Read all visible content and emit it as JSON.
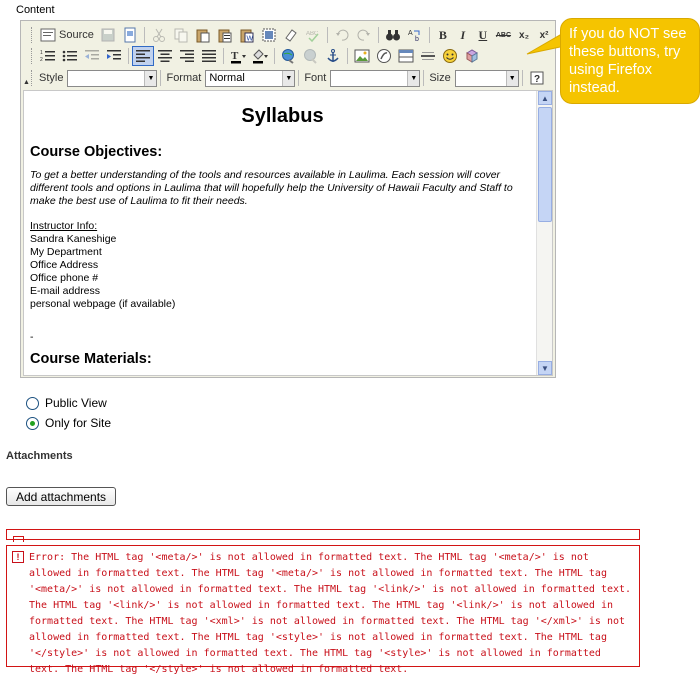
{
  "content_label": "Content",
  "toolbar": {
    "source_label": "Source",
    "bold": "B",
    "italic": "I",
    "underline": "U",
    "strike": "ABC",
    "subscript": "x₂",
    "superscript": "x²",
    "style_label": "Style",
    "style_value": "",
    "format_label": "Format",
    "format_value": "Normal",
    "font_label": "Font",
    "font_value": "",
    "size_label": "Size",
    "size_value": ""
  },
  "document": {
    "title": "Syllabus",
    "objectives_heading": "Course Objectives:",
    "objectives_text": "To get a better understanding of the tools and resources available in Laulima.  Each session will cover different tools and options in Laulima that will hopefully help the University of Hawaii Faculty and Staff to make the best use of Laulima to fit their needs.",
    "instructor_heading": "Instructor Info:",
    "instructor_lines": [
      "Sandra Kaneshige",
      "My Department",
      "Office Address",
      "Office phone #",
      "E-mail address",
      "personal webpage (if available)"
    ],
    "dash": "-",
    "materials_heading": "Course Materials:"
  },
  "callout": {
    "text": "If you do NOT see these buttons, try using Firefox instead."
  },
  "visibility": {
    "public_label": "Public View",
    "site_label": "Only for Site",
    "selected": "site"
  },
  "attachments": {
    "heading": "Attachments",
    "button_label": "Add attachments"
  },
  "error": {
    "text": "Error: The HTML tag '<meta/>' is not allowed in formatted text. The HTML tag '<meta/>' is not allowed in formatted text. The HTML tag '<meta/>' is not allowed in formatted text. The HTML tag '<meta/>' is not allowed in formatted text. The HTML tag '<link/>' is not allowed in formatted text. The HTML tag '<link/>' is not allowed in formatted text. The HTML tag '<link/>' is not allowed in formatted text. The HTML tag '<xml>' is not allowed in formatted text. The HTML tag '</xml>' is not allowed in formatted text. The HTML tag '<style>' is not allowed in formatted text. The HTML tag '</style>' is not allowed in formatted text. The HTML tag '<style>' is not allowed in formatted text. The HTML tag '</style>' is not allowed in formatted text."
  },
  "colors": {
    "callout": "#f5c400",
    "error": "#c8101a",
    "radio_checked": "#21a121"
  }
}
